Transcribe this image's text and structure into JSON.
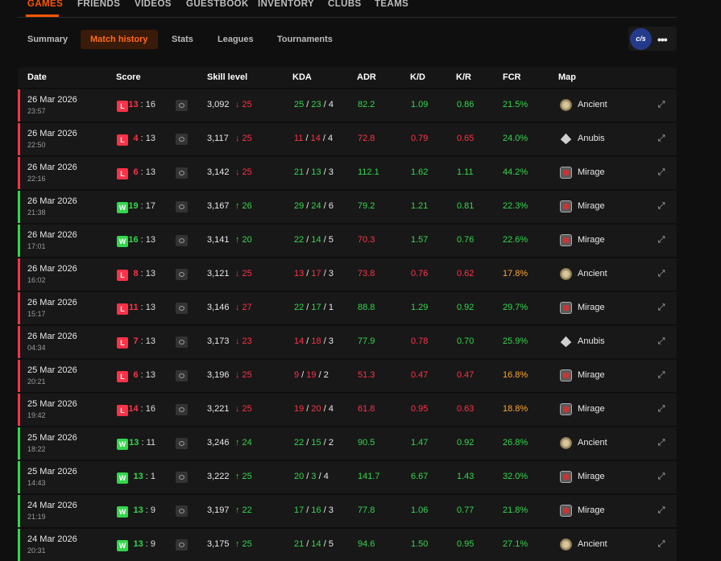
{
  "colors": {
    "accent": "#ff5500",
    "loss": "#ff3146",
    "win": "#32d74b",
    "warn": "#ffa52a"
  },
  "topnav": {
    "tabs": [
      "GAMES",
      "FRIENDS",
      "VIDEOS",
      "GUESTBOOK",
      "INVENTORY",
      "CLUBS",
      "TEAMS"
    ]
  },
  "subnav": {
    "tabs": [
      "Summary",
      "Match history",
      "Stats",
      "Leagues",
      "Tournaments"
    ],
    "brand": "c/s",
    "more": "•••"
  },
  "table": {
    "headers": [
      "Date",
      "Score",
      "Skill level",
      "KDA",
      "ADR",
      "K/D",
      "K/R",
      "FCR",
      "Map"
    ],
    "rows": [
      {
        "date": "26 Mar 2026",
        "time": "23:57",
        "result": "L",
        "own": "13",
        "opp": "16",
        "skill": "3,092",
        "delta": "↓ 25",
        "k": "25",
        "d": "23",
        "a": "4",
        "adr": "82.2",
        "kd": "1.09",
        "kr": "0.86",
        "fcr": "21.5%",
        "map": "Ancient"
      },
      {
        "date": "26 Mar 2026",
        "time": "22:50",
        "result": "L",
        "own": "4",
        "opp": "13",
        "skill": "3,117",
        "delta": "↓ 25",
        "k": "11",
        "d": "14",
        "a": "4",
        "adr": "72.8",
        "kd": "0.79",
        "kr": "0.65",
        "fcr": "24.0%",
        "map": "Anubis"
      },
      {
        "date": "26 Mar 2026",
        "time": "22:16",
        "result": "L",
        "own": "6",
        "opp": "13",
        "skill": "3,142",
        "delta": "↓ 25",
        "k": "21",
        "d": "13",
        "a": "3",
        "adr": "112.1",
        "kd": "1.62",
        "kr": "1.11",
        "fcr": "44.2%",
        "map": "Mirage"
      },
      {
        "date": "26 Mar 2026",
        "time": "21:38",
        "result": "W",
        "own": "19",
        "opp": "17",
        "skill": "3,167",
        "delta": "↑ 26",
        "k": "29",
        "d": "24",
        "a": "6",
        "adr": "79.2",
        "kd": "1.21",
        "kr": "0.81",
        "fcr": "22.3%",
        "map": "Mirage"
      },
      {
        "date": "26 Mar 2026",
        "time": "17:01",
        "result": "W",
        "own": "16",
        "opp": "13",
        "skill": "3,141",
        "delta": "↑ 20",
        "k": "22",
        "d": "14",
        "a": "5",
        "adr": "70.3",
        "kd": "1.57",
        "kr": "0.76",
        "fcr": "22.6%",
        "map": "Mirage"
      },
      {
        "date": "26 Mar 2026",
        "time": "16:02",
        "result": "L",
        "own": "8",
        "opp": "13",
        "skill": "3,121",
        "delta": "↓ 25",
        "k": "13",
        "d": "17",
        "a": "3",
        "adr": "73.8",
        "kd": "0.76",
        "kr": "0.62",
        "fcr": "17.8%",
        "map": "Ancient"
      },
      {
        "date": "26 Mar 2026",
        "time": "15:17",
        "result": "L",
        "own": "11",
        "opp": "13",
        "skill": "3,146",
        "delta": "↓ 27",
        "k": "22",
        "d": "17",
        "a": "1",
        "adr": "88.8",
        "kd": "1.29",
        "kr": "0.92",
        "fcr": "29.7%",
        "map": "Mirage"
      },
      {
        "date": "26 Mar 2026",
        "time": "04:34",
        "result": "L",
        "own": "7",
        "opp": "13",
        "skill": "3,173",
        "delta": "↓ 23",
        "k": "14",
        "d": "18",
        "a": "3",
        "adr": "77.9",
        "kd": "0.78",
        "kr": "0.70",
        "fcr": "25.9%",
        "map": "Anubis"
      },
      {
        "date": "25 Mar 2026",
        "time": "20:21",
        "result": "L",
        "own": "6",
        "opp": "13",
        "skill": "3,196",
        "delta": "↓ 25",
        "k": "9",
        "d": "19",
        "a": "2",
        "adr": "51.3",
        "kd": "0.47",
        "kr": "0.47",
        "fcr": "16.8%",
        "map": "Mirage"
      },
      {
        "date": "25 Mar 2026",
        "time": "19:42",
        "result": "L",
        "own": "14",
        "opp": "16",
        "skill": "3,221",
        "delta": "↓ 25",
        "k": "19",
        "d": "20",
        "a": "4",
        "adr": "61.8",
        "kd": "0.95",
        "kr": "0.63",
        "fcr": "18.8%",
        "map": "Mirage"
      },
      {
        "date": "25 Mar 2026",
        "time": "18:22",
        "result": "W",
        "own": "13",
        "opp": "11",
        "skill": "3,246",
        "delta": "↑ 24",
        "k": "22",
        "d": "15",
        "a": "2",
        "adr": "90.5",
        "kd": "1.47",
        "kr": "0.92",
        "fcr": "26.8%",
        "map": "Ancient"
      },
      {
        "date": "25 Mar 2026",
        "time": "14:43",
        "result": "W",
        "own": "13",
        "opp": "1",
        "skill": "3,222",
        "delta": "↑ 25",
        "k": "20",
        "d": "3",
        "a": "4",
        "adr": "141.7",
        "kd": "6.67",
        "kr": "1.43",
        "fcr": "32.0%",
        "map": "Mirage"
      },
      {
        "date": "24 Mar 2026",
        "time": "21:19",
        "result": "W",
        "own": "13",
        "opp": "9",
        "skill": "3,197",
        "delta": "↑ 22",
        "k": "17",
        "d": "16",
        "a": "3",
        "adr": "77.8",
        "kd": "1.06",
        "kr": "0.77",
        "fcr": "21.8%",
        "map": "Mirage"
      },
      {
        "date": "24 Mar 2026",
        "time": "20:31",
        "result": "W",
        "own": "13",
        "opp": "9",
        "skill": "3,175",
        "delta": "↑ 25",
        "k": "21",
        "d": "14",
        "a": "5",
        "adr": "94.6",
        "kd": "1.50",
        "kr": "0.95",
        "fcr": "27.1%",
        "map": "Ancient"
      }
    ]
  }
}
